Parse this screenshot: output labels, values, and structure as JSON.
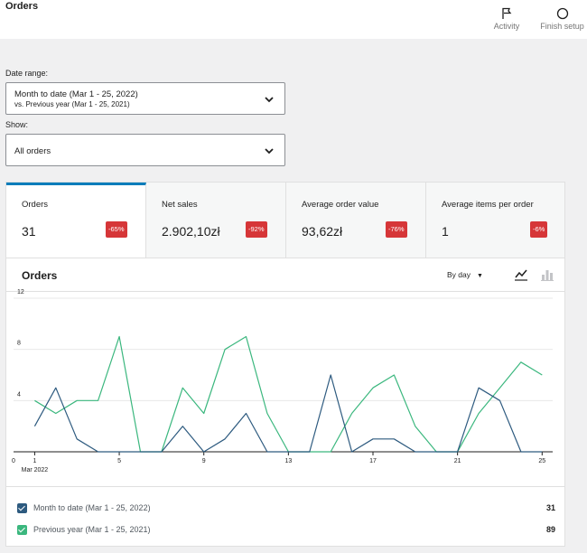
{
  "header": {
    "title": "Orders",
    "actions": [
      {
        "label": "Activity",
        "icon": "flag-icon"
      },
      {
        "label": "Finish setup",
        "icon": "circle-icon"
      }
    ]
  },
  "filters": {
    "date_range_label": "Date range:",
    "date_range_value": "Month to date (Mar 1 - 25, 2022)",
    "date_range_compare": "vs. Previous year (Mar 1 - 25, 2021)",
    "show_label": "Show:",
    "show_value": "All orders"
  },
  "kpis": [
    {
      "label": "Orders",
      "value": "31",
      "delta": "-65%",
      "active": true
    },
    {
      "label": "Net sales",
      "value": "2.902,10zł",
      "delta": "-92%",
      "active": false
    },
    {
      "label": "Average order value",
      "value": "93,62zł",
      "delta": "-76%",
      "active": false
    },
    {
      "label": "Average items per order",
      "value": "1",
      "delta": "-6%",
      "active": false
    }
  ],
  "chart": {
    "title": "Orders",
    "interval": "By day",
    "colors": {
      "current": "#2d5a7f",
      "previous": "#3bb77e",
      "badge": "#d63638",
      "accent": "#007cba"
    }
  },
  "chart_data": {
    "type": "line",
    "x": [
      1,
      2,
      3,
      4,
      5,
      6,
      7,
      8,
      9,
      10,
      11,
      12,
      13,
      14,
      15,
      16,
      17,
      18,
      19,
      20,
      21,
      22,
      23,
      24,
      25
    ],
    "x_ticks": [
      "0",
      "1",
      "5",
      "9",
      "13",
      "17",
      "21",
      "25"
    ],
    "x_sublabel": "Mar 2022",
    "y_ticks": [
      "0",
      "4",
      "8",
      "12"
    ],
    "ylim": [
      0,
      12
    ],
    "xlim": [
      0,
      25.5
    ],
    "series": [
      {
        "name": "Month to date (Mar 1 - 25, 2022)",
        "values": [
          2,
          5,
          1,
          0,
          0,
          0,
          0,
          2,
          0,
          1,
          3,
          0,
          0,
          0,
          6,
          0,
          1,
          1,
          0,
          0,
          0,
          5,
          4,
          0,
          0
        ]
      },
      {
        "name": "Previous year (Mar 1 - 25, 2021)",
        "values": [
          4,
          3,
          4,
          4,
          9,
          0,
          0,
          5,
          3,
          8,
          9,
          3,
          0,
          0,
          0,
          3,
          5,
          6,
          2,
          0,
          0,
          3,
          5,
          7,
          6
        ]
      }
    ]
  },
  "legend": [
    {
      "label": "Month to date (Mar 1 - 25, 2022)",
      "total": "31"
    },
    {
      "label": "Previous year (Mar 1 - 25, 2021)",
      "total": "89"
    }
  ]
}
